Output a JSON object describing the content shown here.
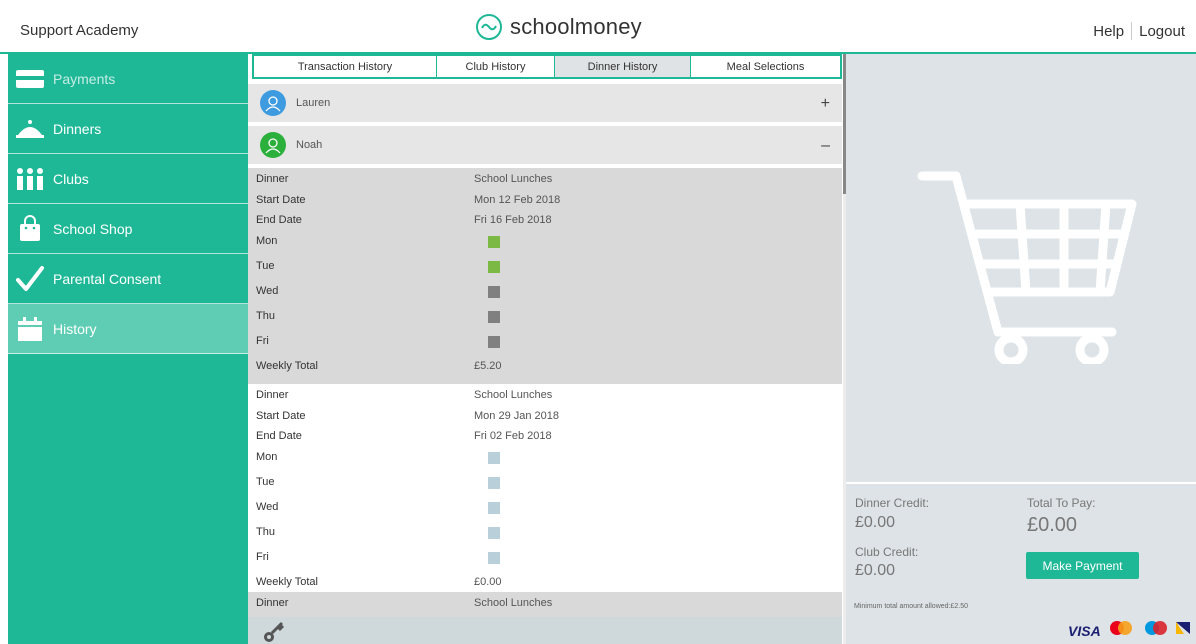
{
  "header": {
    "school": "Support Academy",
    "brand": "schoolmoney",
    "help": "Help",
    "logout": "Logout"
  },
  "sidebar": {
    "items": [
      {
        "label": "Payments",
        "icon": "card-icon"
      },
      {
        "label": "Dinners",
        "icon": "cloche-icon"
      },
      {
        "label": "Clubs",
        "icon": "people-icon"
      },
      {
        "label": "School Shop",
        "icon": "shopping-bag-icon"
      },
      {
        "label": "Parental Consent",
        "icon": "checkmark-icon"
      },
      {
        "label": "History",
        "icon": "calendar-icon"
      }
    ],
    "active": "History"
  },
  "tabs": [
    "Transaction History",
    "Club History",
    "Dinner History",
    "Meal Selections"
  ],
  "active_tab": "Dinner History",
  "children": [
    {
      "name": "Lauren",
      "toggle": "+",
      "avatar_color": "#3e9be0"
    },
    {
      "name": "Noah",
      "toggle": "–",
      "avatar_color": "#2bb03c"
    }
  ],
  "records": [
    {
      "dinner_label": "Dinner",
      "dinner": "School Lunches",
      "start_label": "Start Date",
      "start": "Mon 12 Feb 2018",
      "end_label": "End Date",
      "end": "Fri 16 Feb 2018",
      "days": [
        {
          "day": "Mon",
          "selected": true
        },
        {
          "day": "Tue",
          "selected": true
        },
        {
          "day": "Wed",
          "selected": false
        },
        {
          "day": "Thu",
          "selected": false
        },
        {
          "day": "Fri",
          "selected": false
        }
      ],
      "total_label": "Weekly Total",
      "total": "£5.20"
    },
    {
      "dinner_label": "Dinner",
      "dinner": "School Lunches",
      "start_label": "Start Date",
      "start": "Mon 29 Jan 2018",
      "end_label": "End Date",
      "end": "Fri 02 Feb 2018",
      "days": [
        {
          "day": "Mon",
          "selected": false
        },
        {
          "day": "Tue",
          "selected": false
        },
        {
          "day": "Wed",
          "selected": false
        },
        {
          "day": "Thu",
          "selected": false
        },
        {
          "day": "Fri",
          "selected": false
        }
      ],
      "total_label": "Weekly Total",
      "total": "£0.00"
    },
    {
      "dinner_label": "Dinner",
      "dinner": "School Lunches"
    }
  ],
  "payment": {
    "dinner_credit_label": "Dinner Credit:",
    "dinner_credit": "£0.00",
    "club_credit_label": "Club Credit:",
    "club_credit": "£0.00",
    "total_label": "Total To Pay:",
    "total": "£0.00",
    "button": "Make Payment",
    "min_note": "Minimum total amount allowed:£2.50",
    "cards": [
      "VISA"
    ]
  },
  "colors": {
    "brand": "#1fb897",
    "selected": "#7cb944",
    "unselected_current": "#808080",
    "unselected_past": "#b9cfd9"
  }
}
